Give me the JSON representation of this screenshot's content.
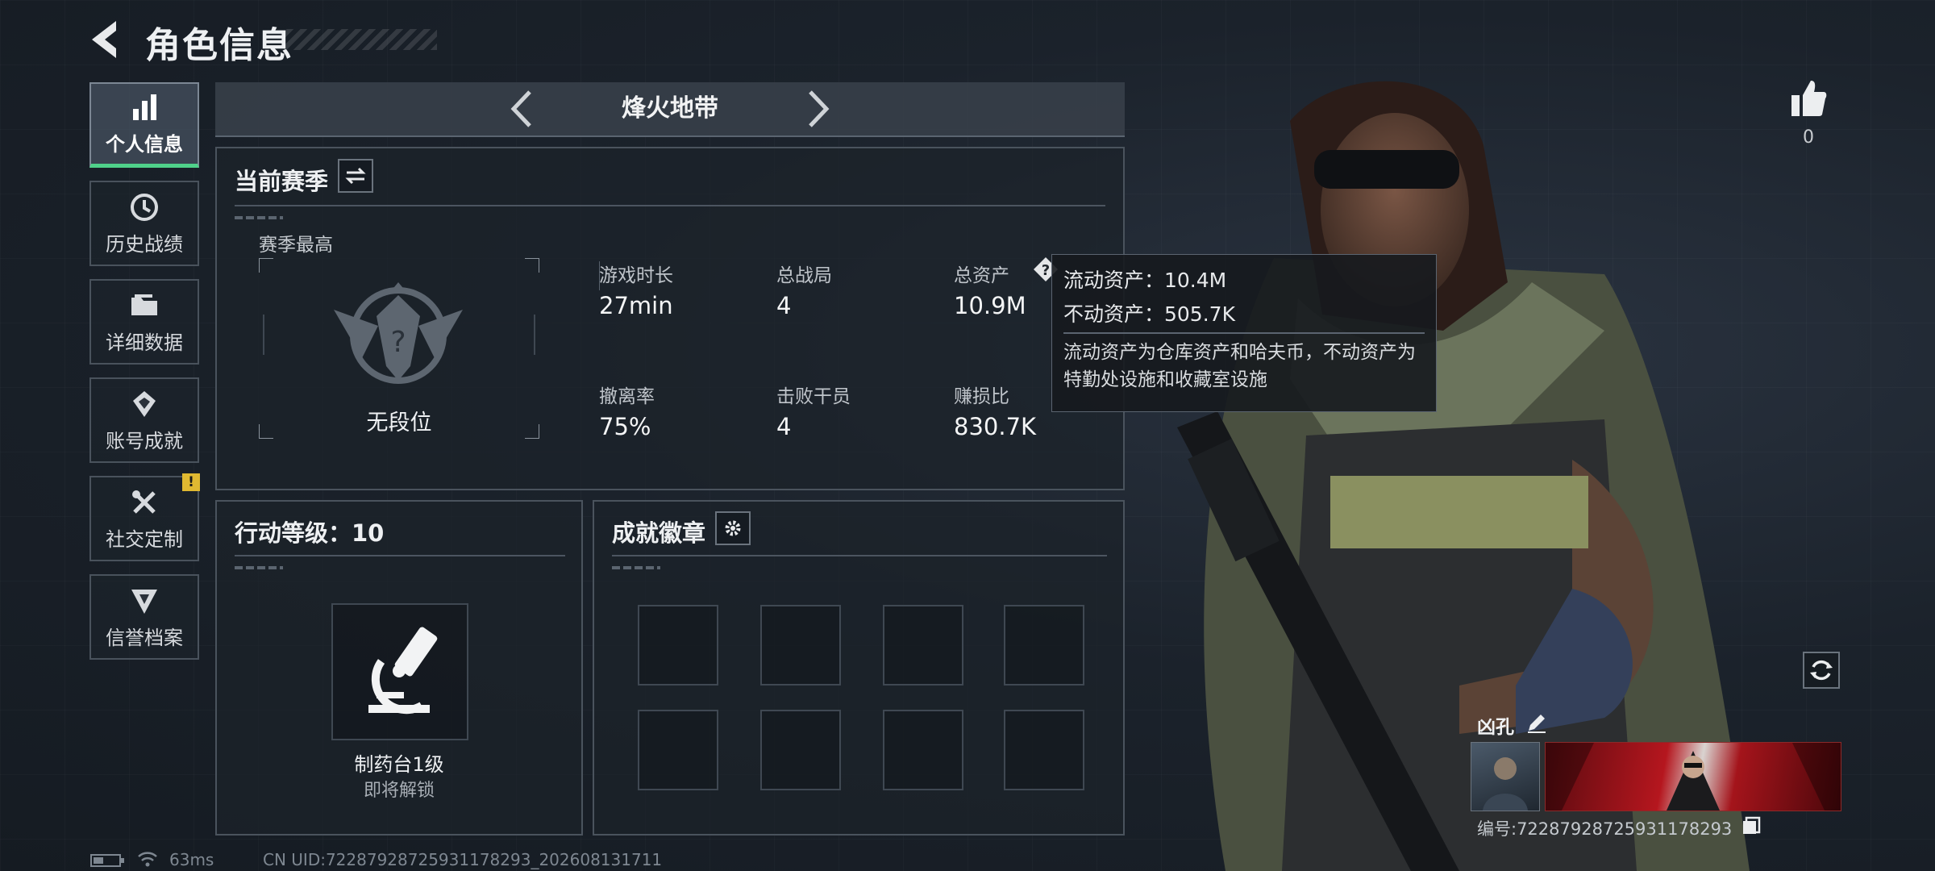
{
  "header": {
    "title": "角色信息"
  },
  "nav": [
    {
      "label": "个人信息",
      "icon": "bar-chart-icon",
      "active": true
    },
    {
      "label": "历史战绩",
      "icon": "history-clock-icon",
      "active": false
    },
    {
      "label": "详细数据",
      "icon": "folder-icon",
      "active": false
    },
    {
      "label": "账号成就",
      "icon": "achievement-icon",
      "active": false
    },
    {
      "label": "社交定制",
      "icon": "tools-icon",
      "active": false,
      "badge": "!"
    },
    {
      "label": "信誉档案",
      "icon": "credit-shield-icon",
      "active": false
    }
  ],
  "mode": {
    "title": "烽火地带"
  },
  "season": {
    "title": "当前赛季",
    "best_label": "赛季最高",
    "rank": "无段位",
    "stats": [
      {
        "label": "游戏时长",
        "value": "27min"
      },
      {
        "label": "总战局",
        "value": "4"
      },
      {
        "label": "总资产",
        "value": "10.9M"
      },
      {
        "label": "撤离率",
        "value": "75%"
      },
      {
        "label": "击败干员",
        "value": "4"
      },
      {
        "label": "赚损比",
        "value": "830.7K"
      }
    ]
  },
  "tooltip": {
    "liquid": "流动资产：10.4M",
    "fixed": "不动资产：505.7K",
    "desc": "流动资产为仓库资产和哈夫币，不动资产为特勤处设施和收藏室设施"
  },
  "action_level": {
    "title": "行动等级：10",
    "item_name": "制药台1级",
    "item_status": "即将解锁"
  },
  "achievements": {
    "title": "成就徽章",
    "slots": 8
  },
  "like": {
    "count": "0"
  },
  "profile": {
    "name": "凶孔",
    "id_text": "编号:72287928725931178293"
  },
  "footer": {
    "ping": "63ms",
    "uid": "CN UID:72287928725931178293_202608131711"
  },
  "colors": {
    "accent": "#4fd18a",
    "warning": "#e0b931"
  }
}
